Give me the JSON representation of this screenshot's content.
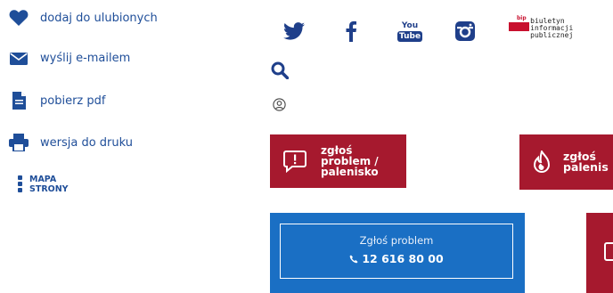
{
  "actions": {
    "favorites_label": "dodaj do ulubionych",
    "email_label": "wyślij e-mailem",
    "pdf_label": "pobierz pdf",
    "print_label": "wersja do druku",
    "sitemap_line1": "MAPA",
    "sitemap_line2": "STRONY"
  },
  "social": {
    "youtube_top": "You",
    "youtube_bottom": "Tube",
    "bip_badge": "bip",
    "bip_line1": "biuletyn",
    "bip_line2": "informacji publicznej"
  },
  "report_buttons": {
    "left_line1": "zgłoś",
    "left_line2": "problem /",
    "left_line3": "palenisko",
    "right_line1": "zgłoś",
    "right_line2": "palenis"
  },
  "hotline": {
    "title": "Zgłoś problem",
    "phone": "12 616 80 00"
  },
  "colors": {
    "brand_blue": "#1f4e99",
    "social_blue": "#1f3f8a",
    "report_red": "#a6192e",
    "hotline_blue": "#1a6fc4"
  }
}
